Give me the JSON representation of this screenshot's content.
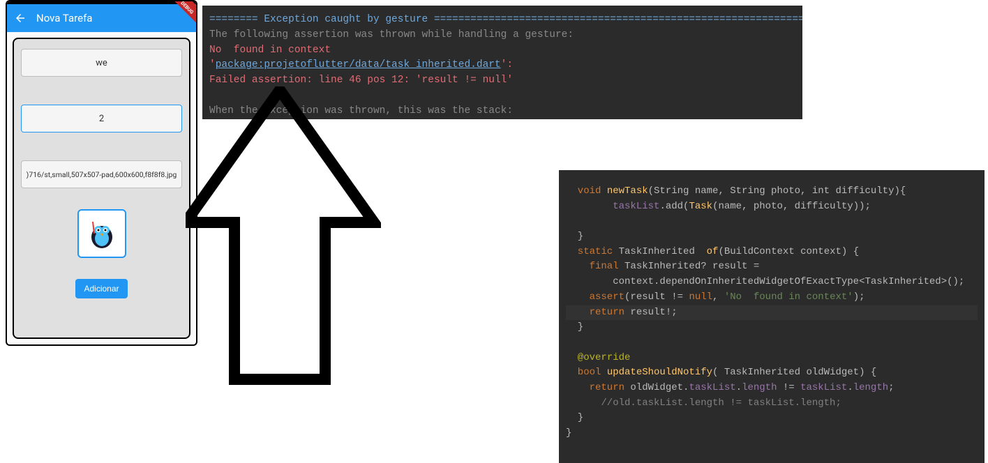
{
  "phone": {
    "title": "Nova Tarefa",
    "debug_banner": "DEBUG",
    "fields": {
      "name_value": "we",
      "difficulty_value": "2",
      "image_value": ")716/st,small,507x507-pad,600x600,f8f8f8.jpg"
    },
    "button_label": "Adicionar"
  },
  "console": {
    "line1": "======== Exception caught by gesture ===============================================================",
    "line2": "The following assertion was thrown while handling a gesture:",
    "line3": "No  found in context",
    "line4a": "'",
    "line4b": "package:projetoflutter/data/task_inherited.dart",
    "line4c": "':",
    "line5": "Failed assertion: line 46 pos 12: 'result != null'",
    "line6": "",
    "line7": "When the exception was thrown, this was the stack:"
  },
  "editor": {
    "l1": {
      "a": "  void ",
      "b": "newTask",
      "c": "(String name, String photo, int difficulty){"
    },
    "l2": {
      "a": "        ",
      "b": "taskList",
      "c": ".add(",
      "d": "Task",
      "e": "(name, photo, difficulty));"
    },
    "l3": "",
    "l4": "  }",
    "l5": {
      "a": "  static ",
      "b": "TaskInherited  ",
      "c": "of",
      "d": "(BuildContext context) {"
    },
    "l6": {
      "a": "    final ",
      "b": "TaskInherited? result ="
    },
    "l7": "        context.dependOnInheritedWidgetOfExactType<TaskInherited>();",
    "l8": {
      "a": "    assert",
      "b": "(result != ",
      "c": "null",
      "d": ", ",
      "e": "'No  found in context'",
      "f": ");"
    },
    "l9": {
      "a": "    return ",
      "b": "result!;"
    },
    "l10": "  }",
    "l11": "",
    "l12": {
      "a": "  @",
      "b": "override"
    },
    "l13": {
      "a": "  bool ",
      "b": "updateShouldNotify",
      "c": "( TaskInherited oldWidget) {"
    },
    "l14": {
      "a": "    return ",
      "b": "oldWidget.",
      "c": "taskList",
      "d": ".",
      "e": "length",
      "f": " != ",
      "g": "taskList",
      "h": ".",
      "i": "length",
      "j": ";"
    },
    "l15": "      //old.taskList.length != taskList.length;",
    "l16": "  }",
    "l17": "}"
  }
}
